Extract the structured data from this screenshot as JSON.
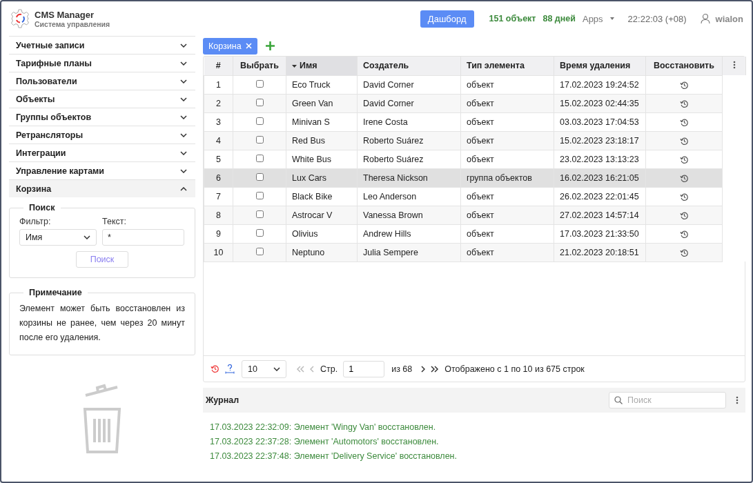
{
  "header": {
    "app_title": "CMS Manager",
    "app_subtitle": "Система управления",
    "dashboard_button": "Дашборд",
    "objects_count": "151 объект",
    "days_count": "88 дней",
    "apps_menu": "Apps",
    "clock": "22:22:03 (+08)",
    "user": "wialon"
  },
  "sidebar": {
    "items": [
      {
        "label": "Учетные записи",
        "expanded": false
      },
      {
        "label": "Тарифные планы",
        "expanded": false
      },
      {
        "label": "Пользователи",
        "expanded": false
      },
      {
        "label": "Объекты",
        "expanded": false
      },
      {
        "label": "Группы объектов",
        "expanded": false
      },
      {
        "label": "Ретрансляторы",
        "expanded": false
      },
      {
        "label": "Интеграции",
        "expanded": false
      },
      {
        "label": "Управление картами",
        "expanded": false
      },
      {
        "label": "Корзина",
        "expanded": true
      }
    ]
  },
  "search_panel": {
    "legend": "Поиск",
    "filter_label": "Фильтр:",
    "filter_value": "Имя",
    "text_label": "Текст:",
    "text_value": "*",
    "button": "Поиск"
  },
  "note": {
    "legend": "Примечание",
    "text": "Элемент может быть восстановлен из корзины не ранее, чем через 20 минут после его удаления."
  },
  "tabs": [
    {
      "label": "Корзина",
      "selected": true
    }
  ],
  "table": {
    "columns": [
      {
        "label": "#",
        "sorted": false
      },
      {
        "label": "Выбрать",
        "sorted": false
      },
      {
        "label": "Имя",
        "sorted": true
      },
      {
        "label": "Создатель",
        "sorted": false
      },
      {
        "label": "Тип элемента",
        "sorted": false
      },
      {
        "label": "Время удаления",
        "sorted": false
      },
      {
        "label": "Восстановить",
        "sorted": false
      }
    ],
    "rows": [
      {
        "number": "1",
        "checked": false,
        "name": "Eco Truck",
        "creator": "David Corner",
        "type": "объект",
        "deleted": "17.02.2023 19:24:52",
        "selected": false
      },
      {
        "number": "2",
        "checked": false,
        "name": "Green Van",
        "creator": "David Corner",
        "type": "объект",
        "deleted": "15.02.2023 02:44:35",
        "selected": false
      },
      {
        "number": "3",
        "checked": false,
        "name": "Minivan S",
        "creator": "Irene Costa",
        "type": "объект",
        "deleted": "03.03.2023 17:04:53",
        "selected": false
      },
      {
        "number": "4",
        "checked": false,
        "name": "Red Bus",
        "creator": "Roberto Suárez",
        "type": "объект",
        "deleted": "15.02.2023 23:18:17",
        "selected": false
      },
      {
        "number": "5",
        "checked": false,
        "name": "White Bus",
        "creator": "Roberto Suárez",
        "type": "объект",
        "deleted": "23.02.2023 13:13:23",
        "selected": false
      },
      {
        "number": "6",
        "checked": false,
        "name": "Lux Cars",
        "creator": "Theresa Nickson",
        "type": "группа объектов",
        "deleted": "16.02.2023 16:21:05",
        "selected": true
      },
      {
        "number": "7",
        "checked": false,
        "name": "Black Bike",
        "creator": "Leo Anderson",
        "type": "объект",
        "deleted": "26.02.2023 22:01:45",
        "selected": false
      },
      {
        "number": "8",
        "checked": false,
        "name": "Astrocar V",
        "creator": "Vanessa Brown",
        "type": "объект",
        "deleted": "27.02.2023 14:57:14",
        "selected": false
      },
      {
        "number": "9",
        "checked": false,
        "name": "Olivius",
        "creator": "Andrew Hills",
        "type": "объект",
        "deleted": "17.03.2023 21:33:50",
        "selected": false
      },
      {
        "number": "10",
        "checked": false,
        "name": "Neptuno",
        "creator": "Julia Sempere",
        "type": "объект",
        "deleted": "21.02.2023 20:18:51",
        "selected": false
      }
    ]
  },
  "pagination": {
    "page_size": "10",
    "page_label": "Стр.",
    "page_value": "1",
    "of_pages": "из 68",
    "summary": "Отображено с 1 по 10 из 675 строк"
  },
  "journal": {
    "title": "Журнал",
    "search_placeholder": "Поиск",
    "entries": [
      "17.03.2023 22:32:09: Элемент 'Wingy Van' восстановлен.",
      "17.03.2023 22:37:28: Элемент 'Automotors' восстановлен.",
      "17.03.2023 22:37:48: Элемент 'Delivery Service' восстановлен."
    ]
  }
}
